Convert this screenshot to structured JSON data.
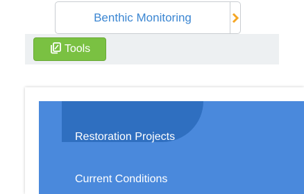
{
  "breadcrumb": {
    "title": "Benthic Monitoring"
  },
  "toolbar": {
    "tools_label": "Tools"
  },
  "menu": {
    "items": [
      {
        "label": "Restoration Projects",
        "active": true
      },
      {
        "label": "Current Conditions",
        "active": false
      }
    ]
  },
  "colors": {
    "link_blue": "#3b86d2",
    "arrow_orange": "#f5a623",
    "tools_green": "#7ac142",
    "menu_blue": "#4a89dc",
    "menu_active_blue": "#2f6fc0",
    "toolbar_gray": "#edf0f2"
  }
}
